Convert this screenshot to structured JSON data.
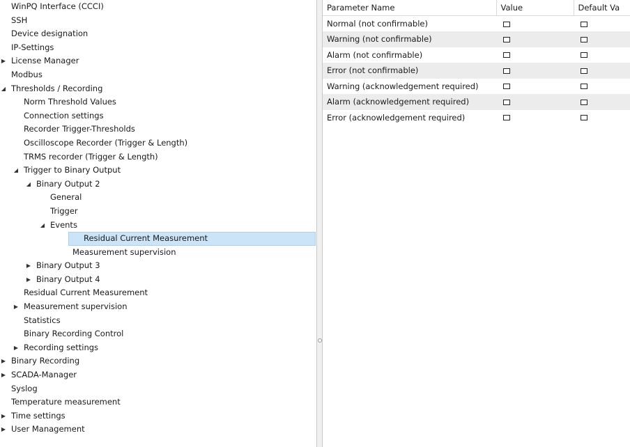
{
  "tree": {
    "items": [
      {
        "label": "WinPQ Interface (CCCI)",
        "level": 0,
        "expander": "none"
      },
      {
        "label": "SSH",
        "level": 0,
        "expander": "none"
      },
      {
        "label": "Device designation",
        "level": 0,
        "expander": "none"
      },
      {
        "label": "IP-Settings",
        "level": 0,
        "expander": "none"
      },
      {
        "label": "License Manager",
        "level": 0,
        "expander": "collapsed"
      },
      {
        "label": "Modbus",
        "level": 0,
        "expander": "none"
      },
      {
        "label": "Thresholds / Recording",
        "level": 0,
        "expander": "expanded"
      },
      {
        "label": "Norm Threshold Values",
        "level": 1,
        "expander": "none"
      },
      {
        "label": "Connection settings",
        "level": 1,
        "expander": "none"
      },
      {
        "label": "Recorder Trigger-Thresholds",
        "level": 1,
        "expander": "none"
      },
      {
        "label": "Oscilloscope Recorder (Trigger & Length)",
        "level": 1,
        "expander": "none"
      },
      {
        "label": "TRMS recorder (Trigger & Length)",
        "level": 1,
        "expander": "none"
      },
      {
        "label": "Trigger to Binary Output",
        "level": 1,
        "expander": "expanded"
      },
      {
        "label": "Binary Output 2",
        "level": 2,
        "expander": "expanded"
      },
      {
        "label": "General",
        "level": 3,
        "expander": "none"
      },
      {
        "label": "Trigger",
        "level": 3,
        "expander": "none"
      },
      {
        "label": "Events",
        "level": 3,
        "expander": "expanded"
      },
      {
        "label": "Residual Current Measurement",
        "level": 4,
        "expander": "none",
        "selected": true
      },
      {
        "label": "Measurement supervision",
        "level": 4,
        "expander": "none"
      },
      {
        "label": "Binary Output 3",
        "level": 2,
        "expander": "collapsed"
      },
      {
        "label": "Binary Output 4",
        "level": 2,
        "expander": "collapsed"
      },
      {
        "label": "Residual Current Measurement",
        "level": 1,
        "expander": "none"
      },
      {
        "label": "Measurement supervision",
        "level": 1,
        "expander": "collapsed"
      },
      {
        "label": "Statistics",
        "level": 1,
        "expander": "none"
      },
      {
        "label": "Binary Recording Control",
        "level": 1,
        "expander": "none"
      },
      {
        "label": "Recording settings",
        "level": 1,
        "expander": "collapsed"
      },
      {
        "label": "Binary Recording",
        "level": 0,
        "expander": "collapsed"
      },
      {
        "label": "SCADA-Manager",
        "level": 0,
        "expander": "collapsed"
      },
      {
        "label": "Syslog",
        "level": 0,
        "expander": "none"
      },
      {
        "label": "Temperature measurement",
        "level": 0,
        "expander": "none"
      },
      {
        "label": "Time settings",
        "level": 0,
        "expander": "collapsed"
      },
      {
        "label": "User Management",
        "level": 0,
        "expander": "collapsed"
      }
    ]
  },
  "grid": {
    "columns": [
      "Parameter Name",
      "Value",
      "Default Va"
    ],
    "rows": [
      {
        "name": "Normal (not confirmable)",
        "value": false,
        "default": false
      },
      {
        "name": "Warning (not confirmable)",
        "value": false,
        "default": false
      },
      {
        "name": "Alarm (not confirmable)",
        "value": false,
        "default": false
      },
      {
        "name": "Error (not confirmable)",
        "value": false,
        "default": false
      },
      {
        "name": "Warning (acknowledgement required)",
        "value": false,
        "default": false
      },
      {
        "name": "Alarm (acknowledgement required)",
        "value": false,
        "default": false
      },
      {
        "name": "Error (acknowledgement required)",
        "value": false,
        "default": false
      }
    ]
  },
  "colors": {
    "selection": "#cce4f7",
    "alt_row": "#ececec"
  }
}
